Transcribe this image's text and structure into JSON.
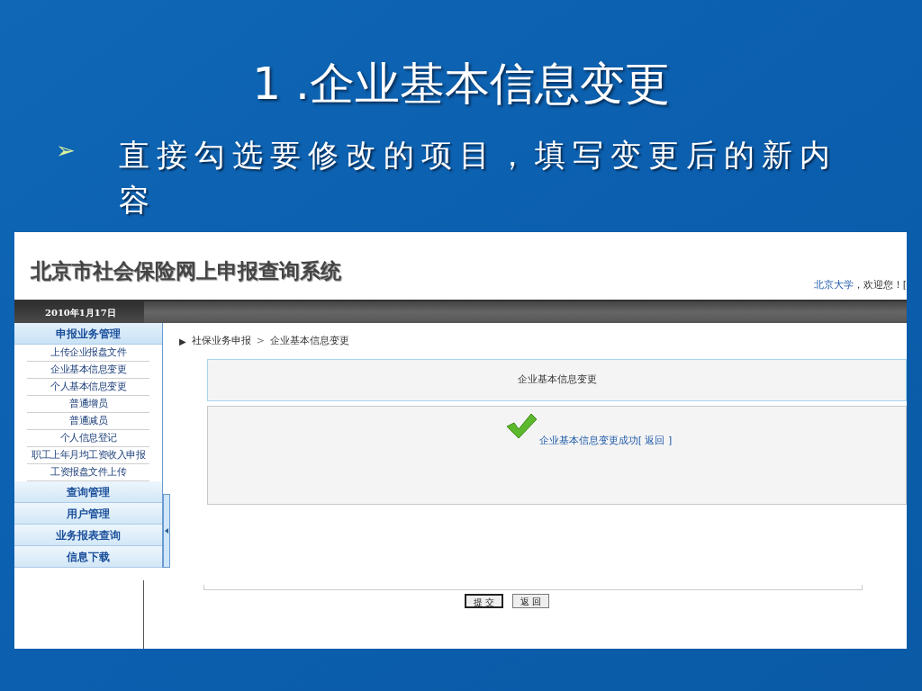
{
  "slide": {
    "title": "1 .企业基本信息变更",
    "bullet_marker": "➢",
    "bullet": "直接勾选要修改的项目，填写变更后的新内容"
  },
  "screen": {
    "system_title": "北京市社会保险网上申报查询系统",
    "user": "北京大学",
    "welcome": "，欢迎您！[",
    "date": "2010年1月17日",
    "menu": [
      {
        "label": "申报业务管理",
        "expanded": true,
        "children": [
          "上传企业报盘文件",
          "企业基本信息变更",
          "个人基本信息变更",
          "普通增员",
          "普通减员",
          "个人信息登记",
          "职工上年月均工资收入申报",
          "工资报盘文件上传"
        ]
      },
      {
        "label": "查询管理",
        "expanded": false
      },
      {
        "label": "用户管理",
        "expanded": false
      },
      {
        "label": "业务报表查询",
        "expanded": false
      },
      {
        "label": "信息下载",
        "expanded": false
      }
    ],
    "breadcrumb_marker": "▶",
    "breadcrumb": [
      "社保业务申报",
      "企业基本信息变更"
    ],
    "breadcrumb_separator": ">",
    "panel_title": "企业基本信息变更",
    "message": "企业基本信息变更成功[ 返回 ]",
    "buttons": [
      "提 交",
      "返 回"
    ]
  }
}
